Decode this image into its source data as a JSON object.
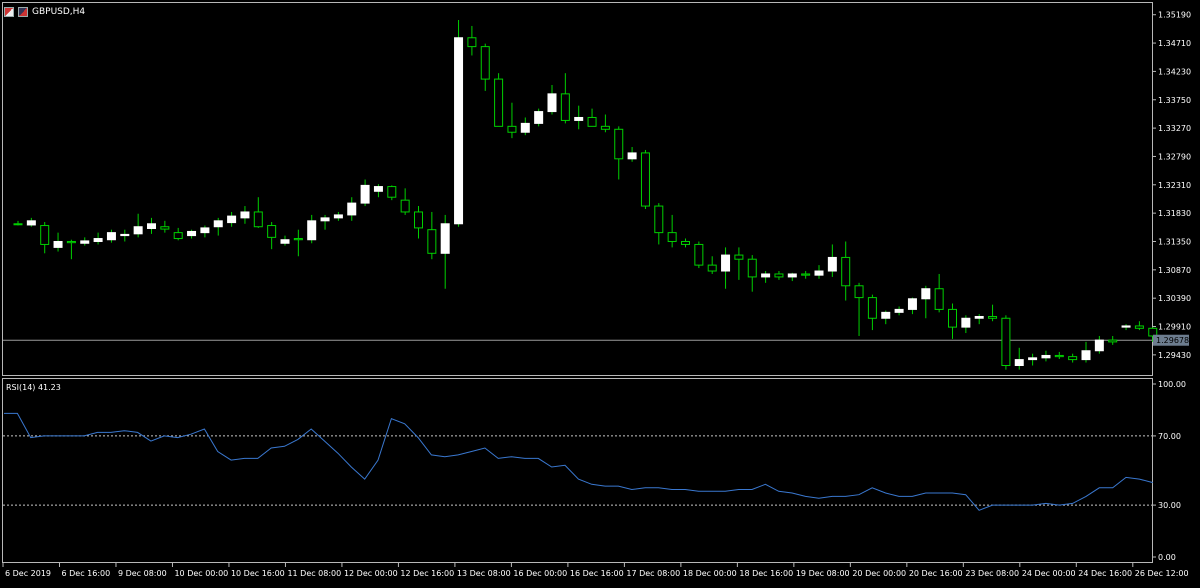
{
  "window": {
    "title": "GBPUSD,H4",
    "icons": [
      "chart-window-icon",
      "symbol-flag-icon"
    ]
  },
  "price_panel": {
    "axis_labels": [
      "1.35190",
      "1.34710",
      "1.34230",
      "1.33750",
      "1.33270",
      "1.32790",
      "1.32310",
      "1.31830",
      "1.31350",
      "1.30870",
      "1.30390",
      "1.29910",
      "1.29430"
    ],
    "current_price": "1.29678",
    "colors": {
      "up_body": "#ffffff",
      "down_body": "#000000",
      "wick": "#00d000",
      "axis": "#ffffff",
      "price_line": "#9a9a9a"
    }
  },
  "rsi_panel": {
    "label": "RSI(14) 41.23",
    "axis_labels": [
      "100.00",
      "70.00",
      "30.00",
      "0.00"
    ],
    "line_color": "#3a78d0"
  },
  "time_axis": {
    "labels": [
      "6 Dec 2019",
      "6 Dec 16:00",
      "9 Dec 08:00",
      "10 Dec 00:00",
      "10 Dec 16:00",
      "11 Dec 08:00",
      "12 Dec 00:00",
      "12 Dec 16:00",
      "13 Dec 08:00",
      "16 Dec 00:00",
      "16 Dec 16:00",
      "17 Dec 08:00",
      "18 Dec 00:00",
      "18 Dec 16:00",
      "19 Dec 08:00",
      "20 Dec 00:00",
      "20 Dec 16:00",
      "23 Dec 08:00",
      "24 Dec 00:00",
      "24 Dec 16:00",
      "26 Dec 12:00"
    ]
  },
  "chart_data": {
    "type": "candlestick",
    "symbol": "GBPUSD",
    "timeframe": "H4",
    "ylim": [
      1.2914,
      1.3527
    ],
    "candles": [
      {
        "o": 1.3165,
        "h": 1.317,
        "l": 1.3162,
        "c": 1.3164
      },
      {
        "o": 1.3163,
        "h": 1.3175,
        "l": 1.316,
        "c": 1.317
      },
      {
        "o": 1.3162,
        "h": 1.3168,
        "l": 1.3115,
        "c": 1.313
      },
      {
        "o": 1.3125,
        "h": 1.315,
        "l": 1.3118,
        "c": 1.3135
      },
      {
        "o": 1.3135,
        "h": 1.3138,
        "l": 1.3105,
        "c": 1.3133
      },
      {
        "o": 1.3132,
        "h": 1.3142,
        "l": 1.3128,
        "c": 1.3136
      },
      {
        "o": 1.3135,
        "h": 1.315,
        "l": 1.313,
        "c": 1.314
      },
      {
        "o": 1.3138,
        "h": 1.3155,
        "l": 1.3133,
        "c": 1.315
      },
      {
        "o": 1.3145,
        "h": 1.3155,
        "l": 1.3135,
        "c": 1.3147
      },
      {
        "o": 1.3148,
        "h": 1.3182,
        "l": 1.3142,
        "c": 1.316
      },
      {
        "o": 1.3157,
        "h": 1.3175,
        "l": 1.3148,
        "c": 1.3165
      },
      {
        "o": 1.316,
        "h": 1.317,
        "l": 1.315,
        "c": 1.3156
      },
      {
        "o": 1.315,
        "h": 1.3158,
        "l": 1.3137,
        "c": 1.314
      },
      {
        "o": 1.3145,
        "h": 1.3155,
        "l": 1.314,
        "c": 1.3152
      },
      {
        "o": 1.315,
        "h": 1.3162,
        "l": 1.3142,
        "c": 1.3158
      },
      {
        "o": 1.316,
        "h": 1.3175,
        "l": 1.3145,
        "c": 1.317
      },
      {
        "o": 1.3167,
        "h": 1.3185,
        "l": 1.316,
        "c": 1.3178
      },
      {
        "o": 1.3175,
        "h": 1.3195,
        "l": 1.3165,
        "c": 1.3185
      },
      {
        "o": 1.3185,
        "h": 1.321,
        "l": 1.3158,
        "c": 1.316
      },
      {
        "o": 1.3162,
        "h": 1.3168,
        "l": 1.3122,
        "c": 1.3142
      },
      {
        "o": 1.3132,
        "h": 1.3145,
        "l": 1.3128,
        "c": 1.3138
      },
      {
        "o": 1.314,
        "h": 1.3155,
        "l": 1.311,
        "c": 1.3138
      },
      {
        "o": 1.3138,
        "h": 1.318,
        "l": 1.3132,
        "c": 1.317
      },
      {
        "o": 1.317,
        "h": 1.318,
        "l": 1.3155,
        "c": 1.3175
      },
      {
        "o": 1.3175,
        "h": 1.3185,
        "l": 1.317,
        "c": 1.318
      },
      {
        "o": 1.318,
        "h": 1.321,
        "l": 1.317,
        "c": 1.32
      },
      {
        "o": 1.32,
        "h": 1.324,
        "l": 1.3195,
        "c": 1.323
      },
      {
        "o": 1.322,
        "h": 1.3232,
        "l": 1.321,
        "c": 1.3228
      },
      {
        "o": 1.3228,
        "h": 1.323,
        "l": 1.3205,
        "c": 1.321
      },
      {
        "o": 1.3205,
        "h": 1.3225,
        "l": 1.318,
        "c": 1.3185
      },
      {
        "o": 1.3185,
        "h": 1.3195,
        "l": 1.314,
        "c": 1.3158
      },
      {
        "o": 1.3155,
        "h": 1.3185,
        "l": 1.3105,
        "c": 1.3115
      },
      {
        "o": 1.3115,
        "h": 1.318,
        "l": 1.3055,
        "c": 1.3165
      },
      {
        "o": 1.3165,
        "h": 1.351,
        "l": 1.316,
        "c": 1.348
      },
      {
        "o": 1.348,
        "h": 1.35,
        "l": 1.345,
        "c": 1.3465
      },
      {
        "o": 1.3465,
        "h": 1.347,
        "l": 1.339,
        "c": 1.341
      },
      {
        "o": 1.341,
        "h": 1.342,
        "l": 1.333,
        "c": 1.333
      },
      {
        "o": 1.333,
        "h": 1.337,
        "l": 1.331,
        "c": 1.332
      },
      {
        "o": 1.332,
        "h": 1.3345,
        "l": 1.3315,
        "c": 1.3335
      },
      {
        "o": 1.3335,
        "h": 1.336,
        "l": 1.333,
        "c": 1.3355
      },
      {
        "o": 1.3355,
        "h": 1.34,
        "l": 1.335,
        "c": 1.3385
      },
      {
        "o": 1.3385,
        "h": 1.342,
        "l": 1.3335,
        "c": 1.334
      },
      {
        "o": 1.334,
        "h": 1.3365,
        "l": 1.3325,
        "c": 1.3345
      },
      {
        "o": 1.3345,
        "h": 1.336,
        "l": 1.333,
        "c": 1.333
      },
      {
        "o": 1.333,
        "h": 1.335,
        "l": 1.332,
        "c": 1.3325
      },
      {
        "o": 1.3325,
        "h": 1.333,
        "l": 1.324,
        "c": 1.3275
      },
      {
        "o": 1.3275,
        "h": 1.3295,
        "l": 1.327,
        "c": 1.3285
      },
      {
        "o": 1.3285,
        "h": 1.329,
        "l": 1.319,
        "c": 1.3195
      },
      {
        "o": 1.3195,
        "h": 1.32,
        "l": 1.313,
        "c": 1.315
      },
      {
        "o": 1.315,
        "h": 1.318,
        "l": 1.3125,
        "c": 1.3135
      },
      {
        "o": 1.3135,
        "h": 1.314,
        "l": 1.3125,
        "c": 1.313
      },
      {
        "o": 1.313,
        "h": 1.3135,
        "l": 1.309,
        "c": 1.3095
      },
      {
        "o": 1.3095,
        "h": 1.311,
        "l": 1.308,
        "c": 1.3085
      },
      {
        "o": 1.3085,
        "h": 1.3125,
        "l": 1.3055,
        "c": 1.3112
      },
      {
        "o": 1.3112,
        "h": 1.3125,
        "l": 1.307,
        "c": 1.3105
      },
      {
        "o": 1.3105,
        "h": 1.3112,
        "l": 1.305,
        "c": 1.3075
      },
      {
        "o": 1.3075,
        "h": 1.3085,
        "l": 1.3065,
        "c": 1.308
      },
      {
        "o": 1.308,
        "h": 1.3085,
        "l": 1.307,
        "c": 1.3075
      },
      {
        "o": 1.3075,
        "h": 1.3082,
        "l": 1.3068,
        "c": 1.308
      },
      {
        "o": 1.308,
        "h": 1.3085,
        "l": 1.3072,
        "c": 1.3078
      },
      {
        "o": 1.3078,
        "h": 1.3095,
        "l": 1.3072,
        "c": 1.3085
      },
      {
        "o": 1.3085,
        "h": 1.313,
        "l": 1.3075,
        "c": 1.3108
      },
      {
        "o": 1.3108,
        "h": 1.3135,
        "l": 1.3035,
        "c": 1.306
      },
      {
        "o": 1.306,
        "h": 1.3065,
        "l": 1.2975,
        "c": 1.304
      },
      {
        "o": 1.304,
        "h": 1.3045,
        "l": 1.2985,
        "c": 1.3005
      },
      {
        "o": 1.3005,
        "h": 1.3018,
        "l": 1.2995,
        "c": 1.3015
      },
      {
        "o": 1.3015,
        "h": 1.3025,
        "l": 1.301,
        "c": 1.302
      },
      {
        "o": 1.302,
        "h": 1.304,
        "l": 1.3012,
        "c": 1.3038
      },
      {
        "o": 1.3038,
        "h": 1.306,
        "l": 1.3005,
        "c": 1.3055
      },
      {
        "o": 1.3055,
        "h": 1.308,
        "l": 1.3015,
        "c": 1.302
      },
      {
        "o": 1.302,
        "h": 1.303,
        "l": 1.297,
        "c": 1.299
      },
      {
        "o": 1.299,
        "h": 1.301,
        "l": 1.298,
        "c": 1.3005
      },
      {
        "o": 1.3005,
        "h": 1.3012,
        "l": 1.2995,
        "c": 1.3008
      },
      {
        "o": 1.3008,
        "h": 1.3028,
        "l": 1.3,
        "c": 1.3005
      },
      {
        "o": 1.3005,
        "h": 1.301,
        "l": 1.2918,
        "c": 1.2925
      },
      {
        "o": 1.2925,
        "h": 1.2955,
        "l": 1.2918,
        "c": 1.2935
      },
      {
        "o": 1.2935,
        "h": 1.2945,
        "l": 1.2925,
        "c": 1.2938
      },
      {
        "o": 1.2938,
        "h": 1.295,
        "l": 1.2932,
        "c": 1.2942
      },
      {
        "o": 1.2942,
        "h": 1.2948,
        "l": 1.2936,
        "c": 1.294
      },
      {
        "o": 1.294,
        "h": 1.2945,
        "l": 1.293,
        "c": 1.2935
      },
      {
        "o": 1.2935,
        "h": 1.2965,
        "l": 1.293,
        "c": 1.295
      },
      {
        "o": 1.295,
        "h": 1.2975,
        "l": 1.2945,
        "c": 1.2968
      },
      {
        "o": 1.2968,
        "h": 1.2975,
        "l": 1.296,
        "c": 1.2965
      },
      {
        "o": 1.299,
        "h": 1.2995,
        "l": 1.2985,
        "c": 1.2992
      },
      {
        "o": 1.2992,
        "h": 1.3,
        "l": 1.2985,
        "c": 1.2988
      },
      {
        "o": 1.2988,
        "h": 1.299,
        "l": 1.2965,
        "c": 1.2975
      }
    ],
    "rsi": {
      "name": "RSI(14) 41.23",
      "ylim": [
        0,
        100
      ],
      "levels": [
        70,
        30
      ],
      "values": [
        83,
        83,
        69,
        70,
        70,
        70,
        70,
        72,
        72,
        73,
        72,
        67,
        70,
        69,
        71,
        74,
        61,
        56,
        57,
        57,
        63,
        64,
        68,
        74,
        67,
        60,
        52,
        45,
        56,
        80,
        77,
        69,
        59,
        58,
        59,
        61,
        63,
        57,
        58,
        57,
        57,
        52,
        53,
        45,
        42,
        41,
        41,
        39,
        40,
        40,
        39,
        39,
        38,
        38,
        38,
        39,
        39,
        42,
        38,
        37,
        35,
        34,
        35,
        35,
        36,
        40,
        37,
        35,
        35,
        37,
        37,
        37,
        36,
        27,
        30,
        30,
        30,
        30,
        31,
        30,
        31,
        35,
        40,
        40,
        46,
        45,
        43
      ]
    }
  }
}
